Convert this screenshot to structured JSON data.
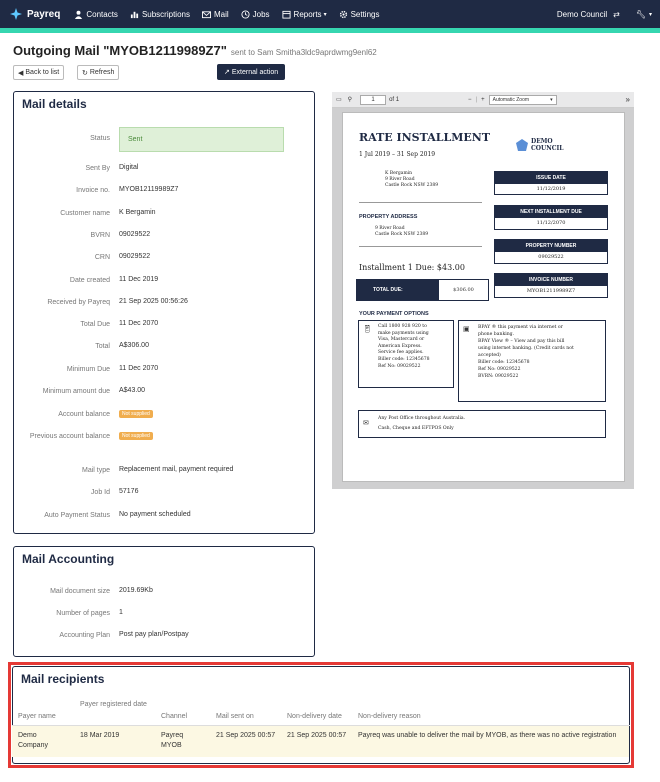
{
  "nav": {
    "brand": "Payreq",
    "items": [
      {
        "label": "Contacts",
        "icon": "user-icon"
      },
      {
        "label": "Subscriptions",
        "icon": "chart-icon"
      },
      {
        "label": "Mail",
        "icon": "envelope-icon"
      },
      {
        "label": "Jobs",
        "icon": "clock-icon"
      },
      {
        "label": "Reports",
        "icon": "calendar-icon"
      },
      {
        "label": "Settings",
        "icon": "gear-icon"
      }
    ],
    "council": "Demo Council"
  },
  "header": {
    "title": "Outgoing Mail \"MYOB12119989Z7\"",
    "subtitle": "sent to Sam Smitha3ldc9aprdwmg9enl62",
    "back_label": "Back to list",
    "refresh_label": "Refresh",
    "external_label": "External action"
  },
  "mail_details": {
    "title": "Mail details",
    "status": {
      "label": "Status",
      "value": "Sent"
    },
    "rows": [
      {
        "label": "Sent By",
        "value": "Digital"
      },
      {
        "label": "Invoice no.",
        "value": "MYOB12119989Z7"
      },
      {
        "label": "Customer name",
        "value": "K Bergamin"
      },
      {
        "label": "BVRN",
        "value": "09029522"
      },
      {
        "label": "CRN",
        "value": "09029522"
      },
      {
        "label": "Date created",
        "value": "11 Dec 2019"
      },
      {
        "label": "Received by Payreq",
        "value": "21 Sep 2025 00:56:26"
      },
      {
        "label": "Total Due",
        "value": "11 Dec 2070"
      },
      {
        "label": "Total",
        "value": "A$306.00"
      },
      {
        "label": "Minimum Due",
        "value": "11 Dec 2070"
      },
      {
        "label": "Minimum amount due",
        "value": "A$43.00"
      }
    ],
    "account_balance": {
      "label": "Account balance",
      "badge": "Not supplied"
    },
    "previous_balance": {
      "label": "Previous account balance",
      "badge": "Not supplied"
    },
    "rows2": [
      {
        "label": "Mail type",
        "value": "Replacement mail, payment required"
      },
      {
        "label": "Job Id",
        "value": "57176"
      },
      {
        "label": "Auto Payment Status",
        "value": "No payment scheduled"
      }
    ]
  },
  "pdf": {
    "page": "1",
    "of": "of 1",
    "zoom": "Automatic Zoom",
    "doc": {
      "title": "RATE INSTALLMENT",
      "period": "1 Jul 2019 – 31 Sep 2019",
      "logo_top": "DEMO",
      "logo_bottom": "COUNCIL",
      "address": [
        "K Bergamin",
        "9 River Road",
        "Castle Rock NSW 2389"
      ],
      "property_label": "PROPERTY ADDRESS",
      "property_address": [
        "9 River Road",
        "Castle Rock NSW 2389"
      ],
      "installment_due": "Installment 1 Due: $43.00",
      "total_due_label": "TOTAL DUE:",
      "total_due_value": "$306.00",
      "boxes": [
        {
          "h": "ISSUE DATE",
          "v": "11/12/2019"
        },
        {
          "h": "NEXT INSTALLMENT DUE",
          "v": "11/12/2070"
        },
        {
          "h": "PROPERTY NUMBER",
          "v": "09029522"
        },
        {
          "h": "INVOICE NUMBER",
          "v": "MYOB12119989Z7"
        }
      ],
      "payment_options_label": "YOUR PAYMENT OPTIONS",
      "phone_text": [
        "Call 1800 928 920 to",
        "make payments using",
        "Visa, Mastercard or",
        "American Express.",
        "Service fee applies.",
        "Biller    code:   12345678",
        "Ref No: 09029522"
      ],
      "bpay_text": [
        "BPAY ® this payment via internet or",
        "phone banking.",
        "BPAY View ® – View and pay this bill",
        "using internet banking. (Credit cards not",
        "accepted)",
        "Biller code: 12345678",
        "Ref No: 09029522",
        "BVRN: 09029522"
      ],
      "post_text": [
        "Any Post Office throughout Australia.",
        "Cash, Cheque and EFTPOS Only"
      ]
    }
  },
  "accounting": {
    "title": "Mail Accounting",
    "rows": [
      {
        "label": "Mail document size",
        "value": "2019.69Kb"
      },
      {
        "label": "Number of pages",
        "value": "1"
      },
      {
        "label": "Accounting Plan",
        "value": "Post pay plan/Postpay"
      }
    ]
  },
  "recipients": {
    "title": "Mail recipients",
    "headers": [
      "Payer name",
      "Payer registered date",
      "Channel",
      "Mail sent on",
      "Non-delivery date",
      "Non-delivery reason"
    ],
    "row": {
      "payer": "Demo Company",
      "registered": "18 Mar 2019",
      "channel": "Payreq MYOB",
      "sent_on": "21 Sep 2025 00:57",
      "nondelivery_date": "21 Sep 2025 00:57",
      "reason": "Payreq was unable to deliver the mail by MYOB, as there was no active registration"
    }
  }
}
